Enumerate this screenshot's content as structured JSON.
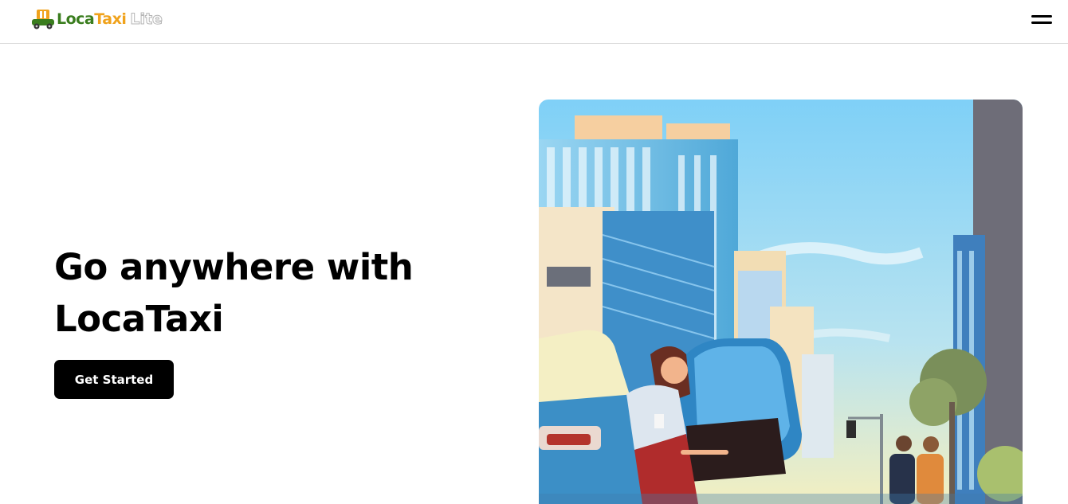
{
  "header": {
    "brand": {
      "loca": "Loca",
      "taxi": "Taxi",
      "lite": "Lite",
      "logo_icon": "taxi-car-icon"
    },
    "menu_icon": "hamburger-menu-icon"
  },
  "hero": {
    "title": "Go anywhere with LocaTaxi",
    "cta_label": "Get Started",
    "illustration": "city-street-taxi-illustration"
  },
  "colors": {
    "brand_green": "#3a7d1e",
    "brand_orange": "#f0a21b",
    "cta_background": "#000000",
    "sky": "#8fd3f4"
  }
}
